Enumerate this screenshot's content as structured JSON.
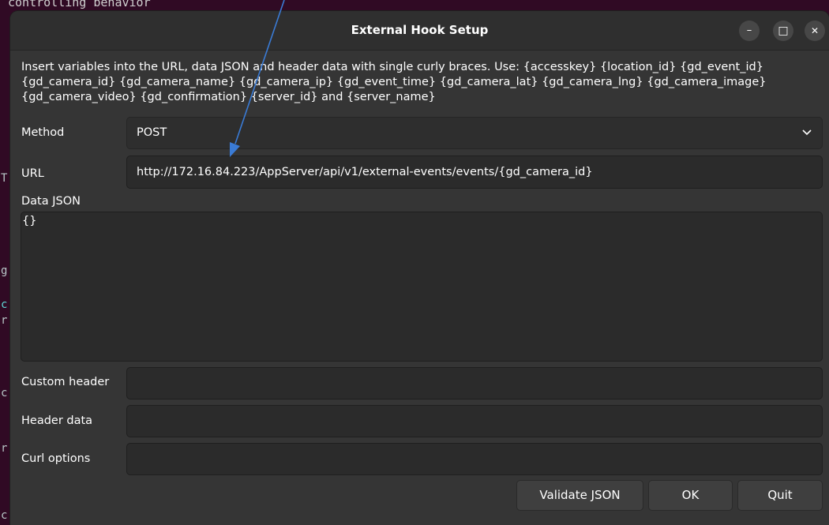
{
  "background": {
    "terminal_text": "controlling behavior",
    "edge_chars": [
      "T",
      "g",
      "c",
      "r",
      "c",
      "r",
      "c"
    ]
  },
  "window": {
    "title": "External Hook Setup",
    "minimize_glyph": "–",
    "maximize_glyph": "□",
    "close_glyph": "✕"
  },
  "info_text": "Insert variables into the URL, data JSON and header data with single curly braces. Use: {accesskey} {location_id} {gd_event_id} {gd_camera_id} {gd_camera_name} {gd_camera_ip} {gd_event_time} {gd_camera_lat} {gd_camera_lng} {gd_camera_image} {gd_camera_video} {gd_confirmation} {server_id} and {server_name}",
  "method": {
    "label": "Method",
    "value": "POST"
  },
  "url": {
    "label": "URL",
    "value": "http://172.16.84.223/AppServer/api/v1/external-events/events/{gd_camera_id}"
  },
  "data_json": {
    "label": "Data JSON",
    "value": "{}"
  },
  "custom_header": {
    "label": "Custom header",
    "value": ""
  },
  "header_data": {
    "label": "Header data",
    "value": ""
  },
  "curl_options": {
    "label": "Curl options",
    "value": ""
  },
  "buttons": {
    "validate": "Validate JSON",
    "ok": "OK",
    "quit": "Quit"
  },
  "colors": {
    "window_bg": "#353535",
    "field_bg": "#2b2b2b",
    "annotation_arrow": "#3a7bd5"
  }
}
